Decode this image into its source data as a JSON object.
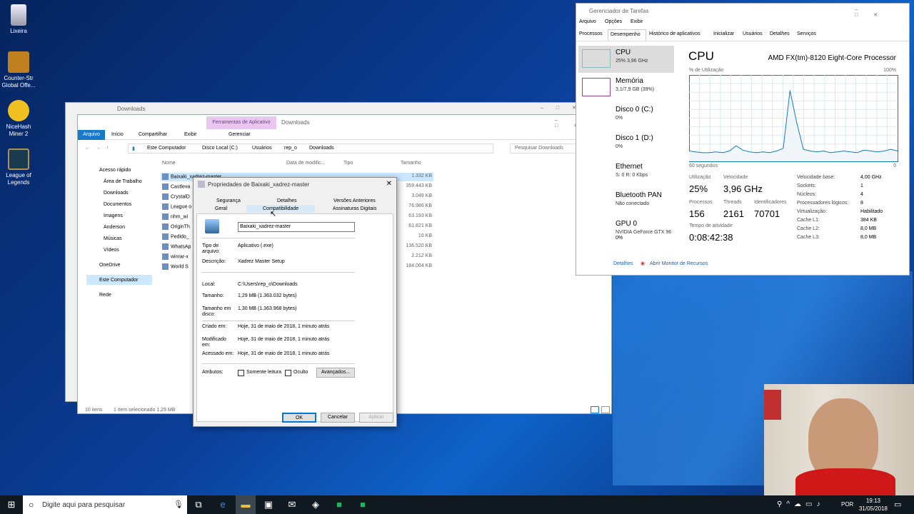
{
  "desktop_icons": [
    {
      "label": "Lixeira"
    },
    {
      "label": "Counter-Str Global Offe..."
    },
    {
      "label": "NiceHash Miner 2"
    },
    {
      "label": "League of Legends"
    }
  ],
  "back_explorer": {
    "title": "Downloads"
  },
  "explorer": {
    "ribbon_context": "Ferramentas de Aplicativo",
    "title": "Downloads",
    "tabs": [
      "Arquivo",
      "Início",
      "Compartilhar",
      "Exibir",
      "Gerenciar"
    ],
    "breadcrumb": [
      "Este Computador",
      "Disco Local (C:)",
      "Usuários",
      "rep_o",
      "Downloads"
    ],
    "search_placeholder": "Pesquisar Downloads",
    "columns": [
      "Nome",
      "Data de modific...",
      "Tipo",
      "Tamanho"
    ],
    "sidebar": [
      "Acesso rápido",
      "Área de Trabalho",
      "Downloads",
      "Documentos",
      "Imagens",
      "Anderson",
      "Músicas",
      "Vídeos",
      "OneDrive",
      "Este Computador",
      "Rede"
    ],
    "files": [
      {
        "name": "Baixaki_xadrez-master",
        "size": "1.332 KB"
      },
      {
        "name": "Castleva",
        "size": "359.443 KB"
      },
      {
        "name": "CrystalD",
        "size": "3.049 KB"
      },
      {
        "name": "League o",
        "size": "76.986 KB"
      },
      {
        "name": "nhm_wi",
        "size": "63.193 KB"
      },
      {
        "name": "OriginTh",
        "size": "61.821 KB"
      },
      {
        "name": "Pedido_",
        "size": "16 KB"
      },
      {
        "name": "WhatsAp",
        "size": "136.520 KB"
      },
      {
        "name": "winrar-x",
        "size": "2.212 KB"
      },
      {
        "name": "World S",
        "size": "184.064 KB"
      }
    ],
    "status_items": "10 itens",
    "status_selected": "1 item selecionado  1,29 MB",
    "left_status": "10"
  },
  "props": {
    "title": "Propriedades de Baixaki_xadrez-master",
    "tabs_row1": [
      "Segurança",
      "Detalhes",
      "Versões Anteriores"
    ],
    "tabs_row2": [
      "Geral",
      "Compatibilidade",
      "Assinaturas Digitais"
    ],
    "filename": "Baixaki_xadrez-master",
    "fields": [
      {
        "label": "Tipo de arquivo:",
        "value": "Aplicativo (.exe)"
      },
      {
        "label": "Descrição:",
        "value": "Xadrez Master Setup"
      },
      {
        "label": "Local:",
        "value": "C:\\Users\\rep_o\\Downloads"
      },
      {
        "label": "Tamanho:",
        "value": "1,29 MB (1.363.032 bytes)"
      },
      {
        "label": "Tamanho em disco:",
        "value": "1,30 MB (1.363.968 bytes)"
      },
      {
        "label": "Criado em:",
        "value": "Hoje, 31 de maio de 2018, 1 minuto atrás"
      },
      {
        "label": "Modificado em:",
        "value": "Hoje, 31 de maio de 2018, 1 minuto atrás"
      },
      {
        "label": "Acessado em:",
        "value": "Hoje, 31 de maio de 2018, 1 minuto atrás"
      }
    ],
    "attributes_label": "Atributos:",
    "readonly_label": "Somente leitura",
    "hidden_label": "Oculto",
    "advanced_label": "Avançados...",
    "ok": "OK",
    "cancel": "Cancelar",
    "apply": "Aplicar"
  },
  "taskmgr": {
    "title": "Gerenciador de Tarefas",
    "menu": [
      "Arquivo",
      "Opções",
      "Exibir"
    ],
    "tabs": [
      "Processos",
      "Desempenho",
      "Histórico de aplicativos",
      "Inicializar",
      "Usuários",
      "Detalhes",
      "Serviços"
    ],
    "resources": [
      {
        "name": "CPU",
        "sub": "25% 3,96 GHz"
      },
      {
        "name": "Memória",
        "sub": "3,1/7,9 GB (39%)"
      },
      {
        "name": "Disco 0 (C:)",
        "sub": "0%"
      },
      {
        "name": "Disco 1 (D:)",
        "sub": "0%"
      },
      {
        "name": "Ethernet",
        "sub": "S: 0 R: 0 Kbps"
      },
      {
        "name": "Bluetooth PAN",
        "sub": "Não conectado"
      },
      {
        "name": "GPU 0",
        "sub": "NVIDIA GeForce GTX 96"
      },
      {
        "name": "",
        "sub": "0%"
      }
    ],
    "heading": "CPU",
    "processor": "AMD FX(tm)-8120 Eight-Core Processor",
    "util_label": "% de Utilização",
    "util_max": "100%",
    "time_label": "60 segundos",
    "time_min": "0",
    "stats": {
      "utilizacao_label": "Utilização",
      "utilizacao": "25%",
      "velocidade_label": "Velocidade",
      "velocidade": "3,96 GHz",
      "processos_label": "Processos",
      "processos": "156",
      "threads_label": "Threads",
      "threads": "2161",
      "ident_label": "Identificadores",
      "ident": "70701",
      "tempo_label": "Tempo de atividade",
      "tempo": "0:08:42:38"
    },
    "specs": [
      {
        "k": "Velocidade base:",
        "v": "4,00 GHz"
      },
      {
        "k": "Sockets:",
        "v": "1"
      },
      {
        "k": "Núcleos:",
        "v": "4"
      },
      {
        "k": "Processadores lógicos:",
        "v": "8"
      },
      {
        "k": "Virtualização:",
        "v": "Habilitado"
      },
      {
        "k": "Cache L1:",
        "v": "384 KB"
      },
      {
        "k": "Cache L2:",
        "v": "8,0 MB"
      },
      {
        "k": "Cache L3:",
        "v": "8,0 MB"
      }
    ],
    "less_details": "Detalhes",
    "resource_monitor": "Abrir Monitor de Recursos",
    "cpu_history": [
      12,
      11,
      10,
      10,
      11,
      10,
      12,
      18,
      13,
      11,
      10,
      11,
      10,
      12,
      15,
      82,
      45,
      14,
      12,
      11,
      12,
      10,
      11,
      12,
      11,
      10,
      13,
      12,
      11,
      12,
      14,
      12
    ]
  },
  "taskbar": {
    "search_placeholder": "Digite aqui para pesquisar",
    "lang": "POR",
    "time": "19:13",
    "date": "31/05/2018"
  },
  "colors": {
    "accent": "#1979ca",
    "ribbon_context": "#e8c8f0",
    "cpu_line": "#117dbb"
  }
}
